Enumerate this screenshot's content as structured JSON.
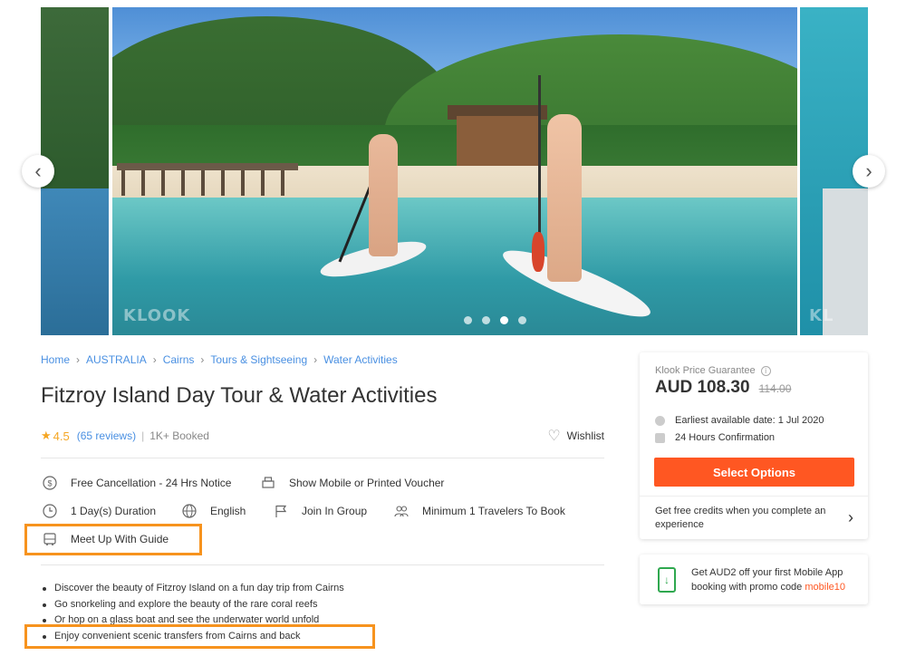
{
  "gallery": {
    "watermark": "KLOOK",
    "side_watermark": "KL",
    "slide_count": 4,
    "active_slide": 3,
    "prev_icon": "chevron-left-icon",
    "next_icon": "chevron-right-icon"
  },
  "breadcrumb": [
    "Home",
    "AUSTRALIA",
    "Cairns",
    "Tours & Sightseeing",
    "Water Activities"
  ],
  "title": "Fitzroy Island Day Tour & Water Activities",
  "rating": {
    "value": "4.5",
    "reviews": "(65 reviews)",
    "separator": "|",
    "booked": "1K+ Booked",
    "wishlist_label": "Wishlist"
  },
  "features": {
    "cancellation": "Free Cancellation - 24 Hrs Notice",
    "voucher": "Show Mobile or Printed Voucher",
    "duration": "1 Day(s) Duration",
    "language": "English",
    "group": "Join In Group",
    "minimum": "Minimum 1 Travelers To Book",
    "meetup": "Meet Up With Guide"
  },
  "highlights": [
    "Discover the beauty of Fitzroy Island on a fun day trip from Cairns",
    "Go snorkeling and explore the beauty of the rare coral reefs",
    "Or hop on a glass boat and see the underwater world unfold",
    "Enjoy convenient scenic transfers from Cairns and back"
  ],
  "price_card": {
    "guarantee": "Klook Price Guarantee",
    "price": "AUD 108.30",
    "old_price": "114.00",
    "earliest_date": "Earliest available date: 1 Jul 2020",
    "confirmation": "24 Hours Confirmation",
    "select_label": "Select Options",
    "credits_text": "Get free credits when you complete an experience"
  },
  "app_card": {
    "text": "Get AUD2 off your first Mobile App booking with promo code",
    "promo_code": "mobile10"
  },
  "colors": {
    "accent": "#ff5722",
    "link": "#4a90e2",
    "star": "#f5a623",
    "highlight_box": "#f7931e"
  }
}
